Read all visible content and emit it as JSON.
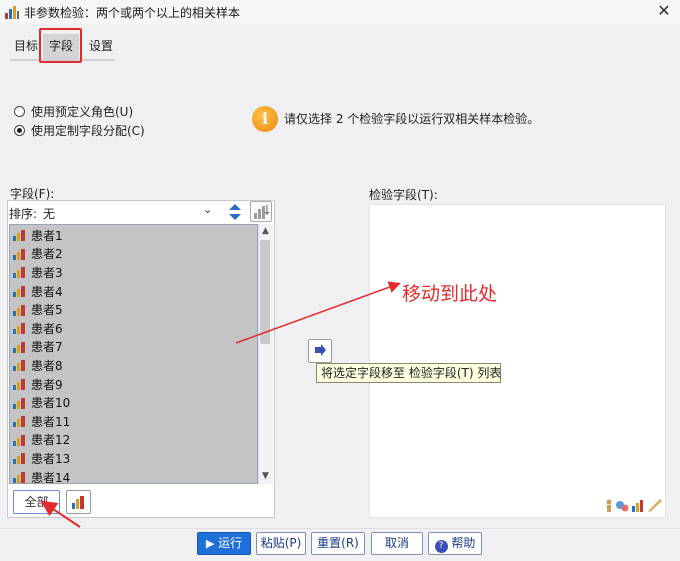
{
  "window": {
    "title": "非参数检验：两个或两个以上的相关样本",
    "close_glyph": "✕"
  },
  "tabs": [
    {
      "label": "目标"
    },
    {
      "label": "字段"
    },
    {
      "label": "设置"
    }
  ],
  "options": {
    "predefined": "使用预定义角色(U)",
    "custom": "使用定制字段分配(C)",
    "selected": "custom"
  },
  "info": {
    "text": "请仅选择 2 个检验字段以运行双相关样本检验。",
    "icon": "info-icon"
  },
  "fields_panel": {
    "label": "字段(F):",
    "sort_label": "排序:",
    "sort_value": "无",
    "items": [
      {
        "label": "患者1"
      },
      {
        "label": "患者2"
      },
      {
        "label": "患者3"
      },
      {
        "label": "患者4"
      },
      {
        "label": "患者5"
      },
      {
        "label": "患者6"
      },
      {
        "label": "患者7"
      },
      {
        "label": "患者8"
      },
      {
        "label": "患者9"
      },
      {
        "label": "患者10"
      },
      {
        "label": "患者11"
      },
      {
        "label": "患者12"
      },
      {
        "label": "患者13"
      },
      {
        "label": "患者14"
      }
    ],
    "all_button": "全部",
    "scroll_up": "▲",
    "scroll_down": "▼",
    "sort_chevron": "⌄"
  },
  "test_panel": {
    "label": "检验字段(T):"
  },
  "move_tooltip": "将选定字段移至 检验字段(T) 列表",
  "annotation": {
    "text": "移动到此处",
    "color": "#e42b2b"
  },
  "footer": {
    "run": "运行",
    "paste": "粘贴(P)",
    "reset": "重置(R)",
    "cancel": "取消",
    "help": "帮助"
  },
  "colors": {
    "accent": "#1e6fd9",
    "highlight": "#e42b2b",
    "list_bg": "#c4c4c6"
  }
}
